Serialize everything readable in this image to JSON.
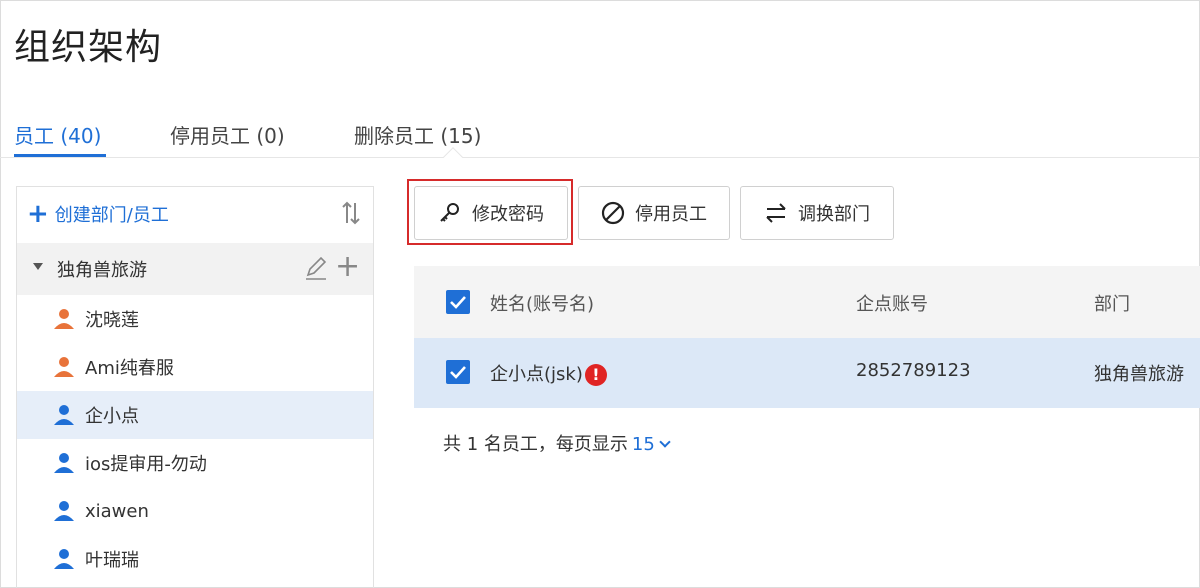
{
  "page": {
    "title": "组织架构"
  },
  "tabs": [
    {
      "label": "员工 (40)",
      "active": true
    },
    {
      "label": "停用员工 (0)",
      "active": false
    },
    {
      "label": "删除员工 (15)",
      "active": false
    }
  ],
  "sidebar": {
    "create_label": "创建部门/员工",
    "department": {
      "name": "独角兽旅游"
    },
    "employees": [
      {
        "name": "沈晓莲",
        "icon_color": "#e8733a",
        "selected": false
      },
      {
        "name": "Ami纯春服",
        "icon_color": "#e8733a",
        "selected": false
      },
      {
        "name": "企小点",
        "icon_color": "#1f6fd6",
        "selected": true
      },
      {
        "name": "ios提审用-勿动",
        "icon_color": "#1f6fd6",
        "selected": false
      },
      {
        "name": "xiawen",
        "icon_color": "#1f6fd6",
        "selected": false
      },
      {
        "name": "叶瑞瑞",
        "icon_color": "#1f6fd6",
        "selected": false
      }
    ]
  },
  "toolbar": {
    "change_password": "修改密码",
    "disable_employee": "停用员工",
    "move_department": "调换部门"
  },
  "table": {
    "headers": {
      "name": "姓名(账号名)",
      "account": "企点账号",
      "dept": "部门"
    },
    "rows": [
      {
        "name": "企小点(jsk)",
        "warning": "!",
        "account": "2852789123",
        "dept": "独角兽旅游",
        "checked": true
      }
    ]
  },
  "footer": {
    "summary": "共 1 名员工，每页显示",
    "page_size": "15"
  },
  "colors": {
    "accent": "#1f6fd6",
    "highlight": "#d62b2b",
    "warning": "#e02424"
  }
}
